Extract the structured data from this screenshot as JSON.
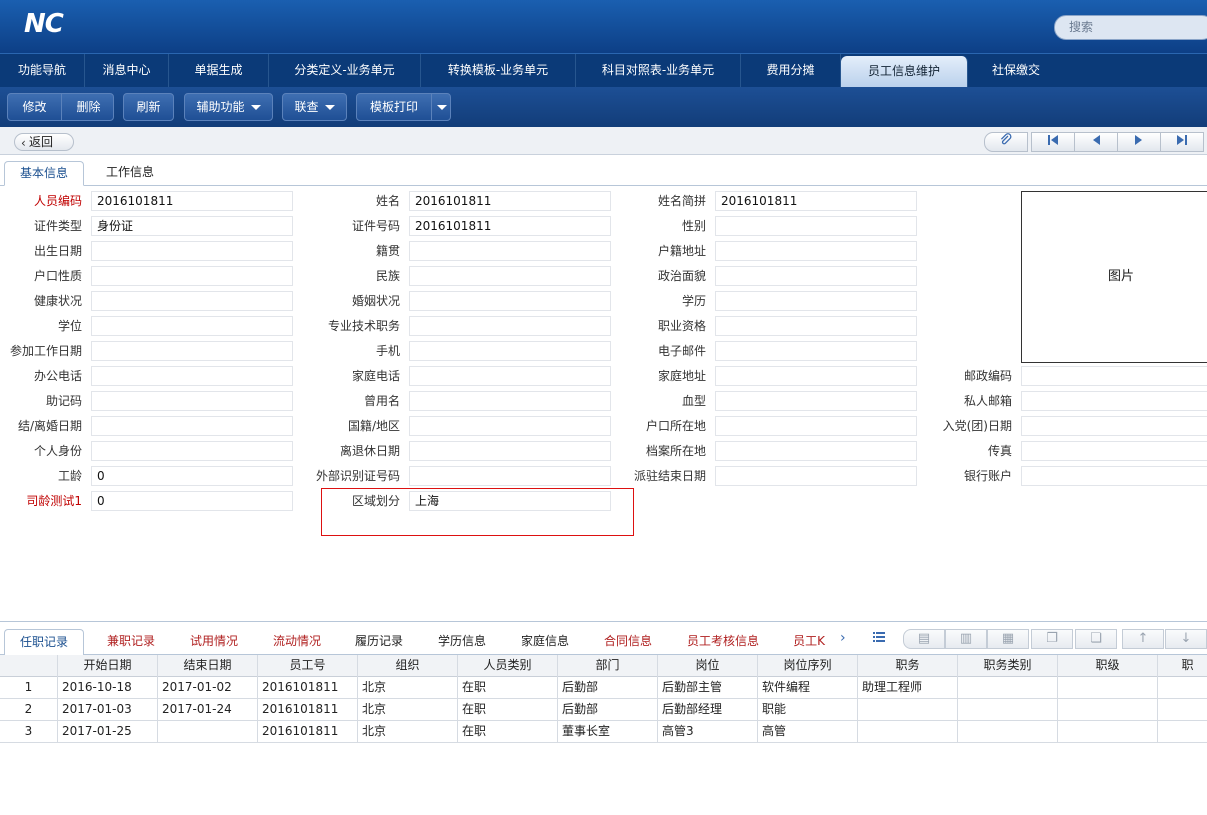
{
  "header": {
    "logo": "NC",
    "search_placeholder": "搜索"
  },
  "main_tabs": [
    "功能导航",
    "消息中心",
    "单据生成",
    "分类定义-业务单元",
    "转换模板-业务单元",
    "科目对照表-业务单元",
    "费用分摊",
    "员工信息维护",
    "社保缴交"
  ],
  "active_main_tab": "员工信息维护",
  "toolbar": {
    "edit": "修改",
    "delete": "删除",
    "refresh": "刷新",
    "assist": "辅助功能",
    "link_query": "联查",
    "template_print": "模板打印"
  },
  "nav": {
    "back": "返回",
    "icons": [
      "attachment-icon",
      "first-record-icon",
      "previous-record-icon",
      "next-record-icon",
      "last-record-icon"
    ]
  },
  "sub_tabs": [
    "基本信息",
    "工作信息"
  ],
  "form": {
    "col1": [
      {
        "label": "人员编码",
        "value": "2016101811",
        "required": true
      },
      {
        "label": "证件类型",
        "value": "身份证"
      },
      {
        "label": "出生日期",
        "value": ""
      },
      {
        "label": "户口性质",
        "value": ""
      },
      {
        "label": "健康状况",
        "value": ""
      },
      {
        "label": "学位",
        "value": ""
      },
      {
        "label": "参加工作日期",
        "value": ""
      },
      {
        "label": "办公电话",
        "value": ""
      },
      {
        "label": "助记码",
        "value": ""
      },
      {
        "label": "结/离婚日期",
        "value": ""
      },
      {
        "label": "个人身份",
        "value": ""
      },
      {
        "label": "工龄",
        "value": "0"
      },
      {
        "label": "司龄测试1",
        "value": "0",
        "required": true
      }
    ],
    "col2": [
      {
        "label": "姓名",
        "value": "2016101811"
      },
      {
        "label": "证件号码",
        "value": "2016101811"
      },
      {
        "label": "籍贯",
        "value": ""
      },
      {
        "label": "民族",
        "value": ""
      },
      {
        "label": "婚姻状况",
        "value": ""
      },
      {
        "label": "专业技术职务",
        "value": ""
      },
      {
        "label": "手机",
        "value": ""
      },
      {
        "label": "家庭电话",
        "value": ""
      },
      {
        "label": "曾用名",
        "value": ""
      },
      {
        "label": "国籍/地区",
        "value": ""
      },
      {
        "label": "离退休日期",
        "value": ""
      },
      {
        "label": "外部识别证号码",
        "value": ""
      },
      {
        "label": "区域划分",
        "value": "上海"
      }
    ],
    "col3": [
      {
        "label": "姓名简拼",
        "value": "2016101811"
      },
      {
        "label": "性别",
        "value": ""
      },
      {
        "label": "户籍地址",
        "value": ""
      },
      {
        "label": "政治面貌",
        "value": ""
      },
      {
        "label": "学历",
        "value": ""
      },
      {
        "label": "职业资格",
        "value": ""
      },
      {
        "label": "电子邮件",
        "value": ""
      },
      {
        "label": "家庭地址",
        "value": ""
      },
      {
        "label": "血型",
        "value": ""
      },
      {
        "label": "户口所在地",
        "value": ""
      },
      {
        "label": "档案所在地",
        "value": ""
      },
      {
        "label": "派驻结束日期",
        "value": ""
      }
    ],
    "col4": [
      {
        "label": "邮政编码",
        "value": ""
      },
      {
        "label": "私人邮箱",
        "value": ""
      },
      {
        "label": "入党(团)日期",
        "value": ""
      },
      {
        "label": "传真",
        "value": ""
      },
      {
        "label": "银行账户",
        "value": ""
      }
    ],
    "photo_label": "图片"
  },
  "bottom_tabs": [
    {
      "label": "任职记录",
      "style": "active"
    },
    {
      "label": "兼职记录",
      "style": "red"
    },
    {
      "label": "试用情况",
      "style": "red"
    },
    {
      "label": "流动情况",
      "style": "red"
    },
    {
      "label": "履历记录",
      "style": "dark"
    },
    {
      "label": "学历信息",
      "style": "dark"
    },
    {
      "label": "家庭信息",
      "style": "dark"
    },
    {
      "label": "合同信息",
      "style": "red"
    },
    {
      "label": "员工考核信息",
      "style": "red"
    },
    {
      "label": "员工K",
      "style": "red"
    }
  ],
  "table": {
    "columns": [
      "开始日期",
      "结束日期",
      "员工号",
      "组织",
      "人员类别",
      "部门",
      "岗位",
      "岗位序列",
      "职务",
      "职务类别",
      "职级",
      "职"
    ],
    "rows": [
      [
        "1",
        "2016-10-18",
        "2017-01-02",
        "2016101811",
        "北京",
        "在职",
        "后勤部",
        "后勤部主管",
        "软件编程",
        "助理工程师",
        "",
        "",
        ""
      ],
      [
        "2",
        "2017-01-03",
        "2017-01-24",
        "2016101811",
        "北京",
        "在职",
        "后勤部",
        "后勤部经理",
        "职能",
        "",
        "",
        "",
        ""
      ],
      [
        "3",
        "2017-01-25",
        "",
        "2016101811",
        "北京",
        "在职",
        "董事长室",
        "高管3",
        "高管",
        "",
        "",
        "",
        ""
      ]
    ]
  }
}
